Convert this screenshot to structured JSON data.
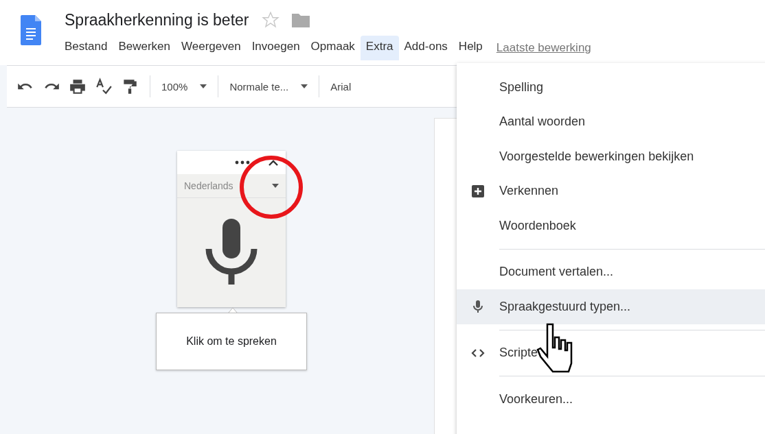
{
  "document": {
    "title": "Spraakherkenning is beter"
  },
  "menu_bar": [
    {
      "label": "Bestand",
      "selected": false
    },
    {
      "label": "Bewerken",
      "selected": false
    },
    {
      "label": "Weergeven",
      "selected": false
    },
    {
      "label": "Invoegen",
      "selected": false
    },
    {
      "label": "Opmaak",
      "selected": false
    },
    {
      "label": "Extra",
      "selected": true
    },
    {
      "label": "Add-ons",
      "selected": false
    },
    {
      "label": "Help",
      "selected": false
    }
  ],
  "last_edit": "Laatste bewerking",
  "toolbar": {
    "zoom": "100%",
    "style": "Normale te...",
    "font": "Arial"
  },
  "voice_typing": {
    "language": "Nederlands",
    "hint": "Klik om te spreken"
  },
  "extra_menu": [
    {
      "kind": "plain",
      "label": "Spelling",
      "selected": false
    },
    {
      "kind": "plain",
      "label": "Aantal woorden",
      "selected": false
    },
    {
      "kind": "plain",
      "label": "Voorgestelde bewerkingen bekijken",
      "selected": false
    },
    {
      "kind": "explore",
      "label": "Verkennen",
      "selected": false
    },
    {
      "kind": "plain",
      "label": "Woordenboek",
      "selected": false
    },
    {
      "kind": "separator"
    },
    {
      "kind": "plain",
      "label": "Document vertalen...",
      "selected": false
    },
    {
      "kind": "voice",
      "label": "Spraakgestuurd typen...",
      "selected": true
    },
    {
      "kind": "separator"
    },
    {
      "kind": "script",
      "label": "Scripte",
      "selected": false
    },
    {
      "kind": "separator"
    },
    {
      "kind": "plain",
      "label": "Voorkeuren...",
      "selected": false
    }
  ]
}
